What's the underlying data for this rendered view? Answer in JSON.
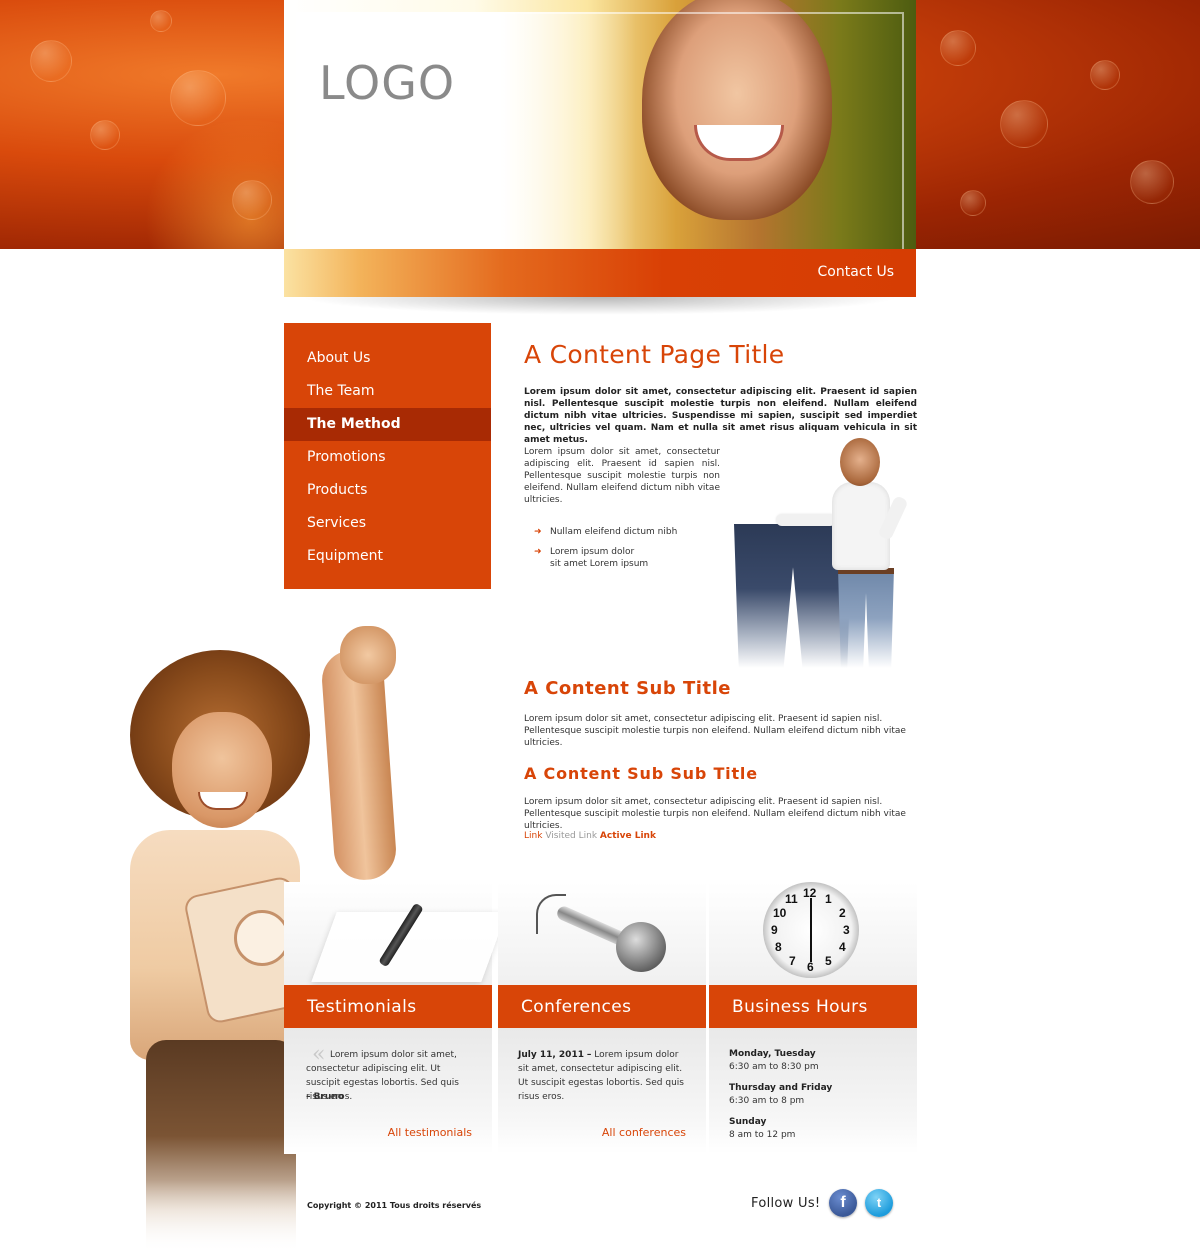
{
  "header": {
    "logo": "LOGO",
    "contact_label": "Contact Us"
  },
  "nav": {
    "items": [
      {
        "label": "About Us"
      },
      {
        "label": "The Team"
      },
      {
        "label": "The Method",
        "active": true
      },
      {
        "label": "Promotions"
      },
      {
        "label": "Products"
      },
      {
        "label": "Services"
      },
      {
        "label": "Equipment"
      }
    ]
  },
  "content": {
    "title": "A Content Page Title",
    "lead": "Lorem ipsum dolor sit amet, consectetur adipiscing elit. Praesent id sapien nisl. Pellentesque suscipit molestie turpis non eleifend. Nullam eleifend dictum nibh vitae ultricies. Suspendisse mi sapien, suscipit sed imperdiet nec, ultricies vel quam. Nam et nulla sit amet risus aliquam vehicula in sit amet metus.",
    "paragraph": "Lorem ipsum dolor sit amet, consectetur adipiscing elit. Praesent id sapien nisl. Pellentesque suscipit molestie turpis non eleifend. Nullam eleifend dictum nibh vitae ultricies.",
    "bullets": [
      {
        "line1": "Nullam eleifend dictum nibh",
        "line2": ""
      },
      {
        "line1": "Lorem ipsum dolor",
        "line2": "sit amet Lorem ipsum"
      }
    ],
    "sub_title": "A Content Sub Title",
    "sub_paragraph": "Lorem ipsum dolor sit amet, consectetur adipiscing elit. Praesent id sapien nisl. Pellentesque suscipit molestie turpis non eleifend. Nullam eleifend dictum nibh vitae ultricies.",
    "sub_sub_title": "A Content Sub Sub Title",
    "sub_sub_paragraph": "Lorem ipsum dolor sit amet, consectetur adipiscing elit. Praesent id sapien nisl. Pellentesque suscipit molestie turpis non eleifend. Nullam eleifend dictum nibh vitae ultricies.",
    "links": {
      "link": "Link",
      "visited": "Visited Link",
      "active": "Active Link"
    }
  },
  "boxes": {
    "testimonials": {
      "title": "Testimonials",
      "text": "Lorem ipsum dolor sit amet, consectetur adipiscing elit. Ut suscipit egestas lobortis. Sed quis risus eros.",
      "author": "– Bruno",
      "link": "All testimonials"
    },
    "conferences": {
      "title": "Conferences",
      "date": "July 11, 2011",
      "dash": "–",
      "text": "Lorem ipsum dolor sit amet, consectetur adipiscing elit. Ut suscipit egestas lobortis. Sed quis risus eros.",
      "link": "All conferences"
    },
    "hours": {
      "title": "Business Hours",
      "rows": [
        {
          "day": "Monday, Tuesday",
          "time": "6:30 am to 8:30 pm"
        },
        {
          "day": "Thursday and Friday",
          "time": "6:30 am to 8 pm"
        },
        {
          "day": "Sunday",
          "time": "8 am to 12 pm"
        }
      ],
      "clock_numbers": [
        "12",
        "1",
        "2",
        "3",
        "4",
        "5",
        "6",
        "7",
        "8",
        "9",
        "10",
        "11"
      ]
    }
  },
  "footer": {
    "copyright": "Copyright © 2011 Tous droits réservés",
    "follow": "Follow Us!",
    "facebook_glyph": "f",
    "twitter_glyph": "t"
  },
  "colors": {
    "accent": "#d84508",
    "accent_dark": "#a82a04"
  }
}
